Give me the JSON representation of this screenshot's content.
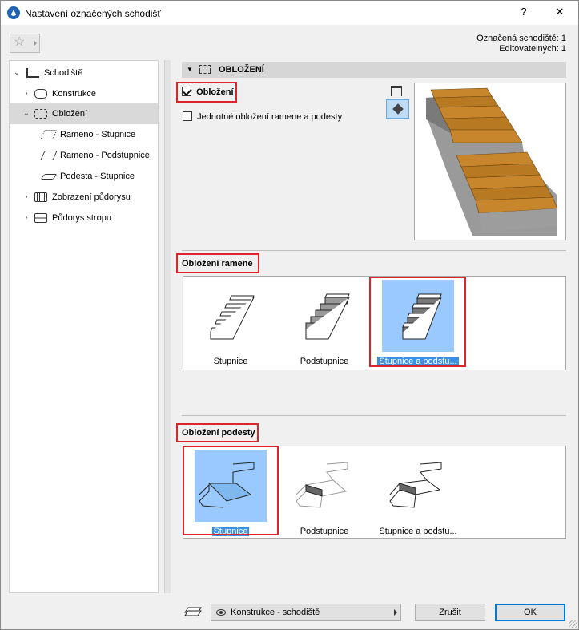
{
  "window": {
    "title": "Nastavení označených schodišť",
    "help": "?",
    "close": "✕"
  },
  "info": {
    "selected": "Označená schodiště: 1",
    "editable": "Editovatelných: 1"
  },
  "tree": {
    "items": [
      {
        "label": "Schodiště",
        "icon": "stair-icon"
      },
      {
        "label": "Konstrukce",
        "icon": "structure-icon"
      },
      {
        "label": "Obložení",
        "icon": "finish-icon"
      },
      {
        "label": "Rameno - Stupnice",
        "icon": "tread-icon"
      },
      {
        "label": "Rameno - Podstupnice",
        "icon": "riser-icon"
      },
      {
        "label": "Podesta - Stupnice",
        "icon": "landing-icon"
      },
      {
        "label": "Zobrazení půdorysu",
        "icon": "floorplan-icon"
      },
      {
        "label": "Půdorys stropu",
        "icon": "ceiling-icon"
      }
    ]
  },
  "panel": {
    "header": "OBLOŽENÍ",
    "finish_checkbox": "Obložení",
    "uniform_checkbox": "Jednotné obložení ramene a podesty",
    "flight_section": "Obložení ramene",
    "flight_options": [
      "Stupnice",
      "Podstupnice",
      "Stupnice a podstu..."
    ],
    "landing_section": "Obložení podesty",
    "landing_options": [
      "Stupnice",
      "Podstupnice",
      "Stupnice a podstu..."
    ]
  },
  "footer": {
    "view_select": "Konstrukce - schodiště",
    "cancel": "Zrušit",
    "ok": "OK"
  },
  "colors": {
    "highlight": "#e0232a",
    "selection": "#99c9ff",
    "tread": "#c8862c",
    "concrete": "#8f8f8f"
  }
}
